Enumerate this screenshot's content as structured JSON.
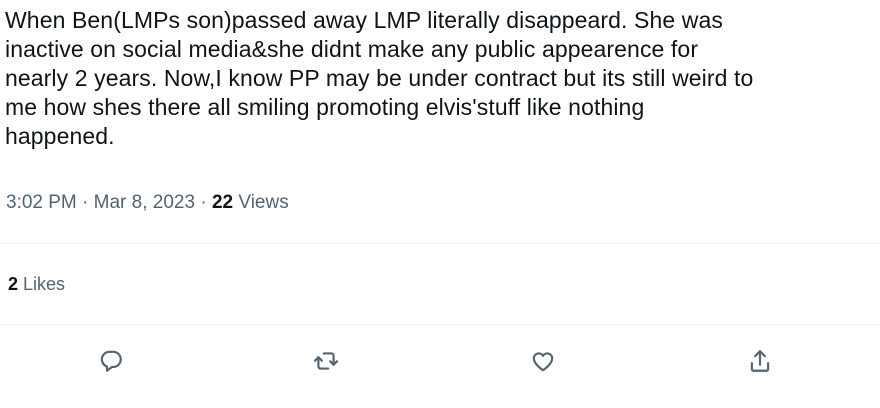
{
  "tweet": {
    "text": "When Ben(LMPs son)passed away LMP literally disappeard. She was\ninactive on social media&she didnt make any public appearence for\nnearly 2 years. Now,I know PP may be under contract but its still weird to\nme how shes there all smiling promoting elvis'stuff like nothing\nhappened.",
    "time": "3:02 PM",
    "separator": " · ",
    "date": "Mar 8, 2023",
    "views_count": "22",
    "views_label": " Views"
  },
  "engagement": {
    "likes_count": "2",
    "likes_label": " Likes"
  },
  "actions": [
    {
      "icon": "reply-icon"
    },
    {
      "icon": "retweet-icon"
    },
    {
      "icon": "like-icon"
    },
    {
      "icon": "share-icon"
    }
  ],
  "colors": {
    "text": "#0f1419",
    "secondary": "#536471",
    "divider": "#eff3f4"
  }
}
